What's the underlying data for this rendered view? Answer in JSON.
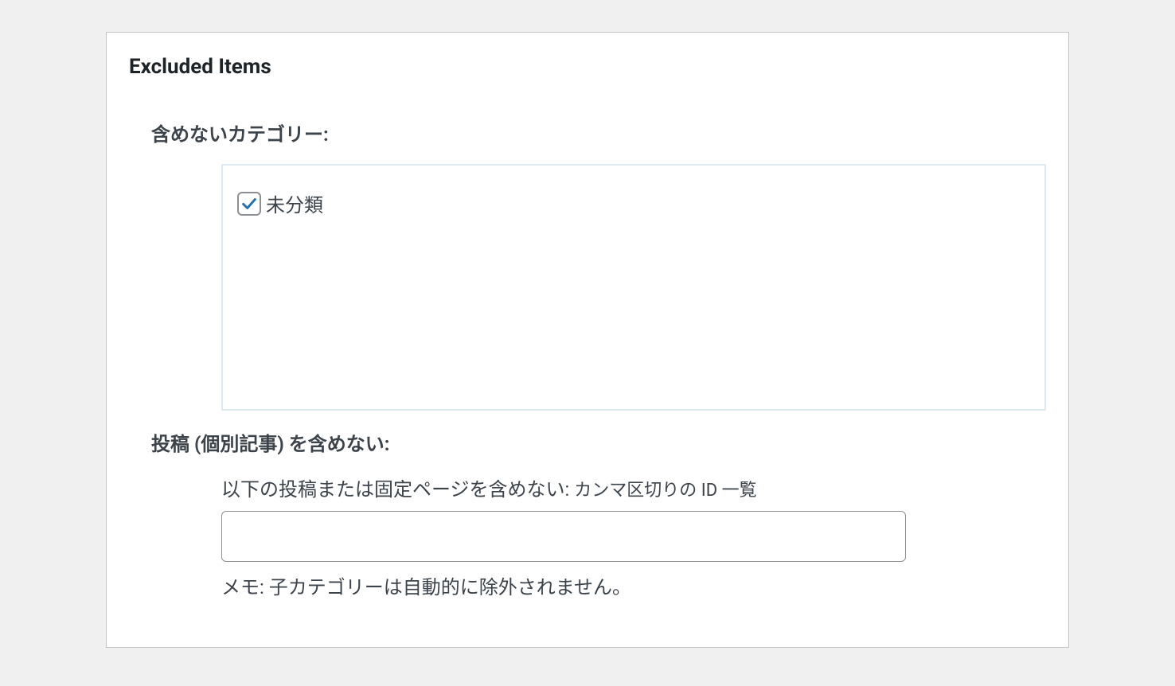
{
  "panel": {
    "title": "Excluded Items"
  },
  "categories": {
    "label": "含めないカテゴリー:",
    "items": [
      {
        "label": "未分類",
        "checked": true
      }
    ]
  },
  "posts": {
    "label": "投稿 (個別記事) を含めない:",
    "sublabel": "以下の投稿または固定ページを含めない: ",
    "hint": "カンマ区切りの ID 一覧",
    "value": "",
    "note": "メモ: 子カテゴリーは自動的に除外されません。"
  }
}
